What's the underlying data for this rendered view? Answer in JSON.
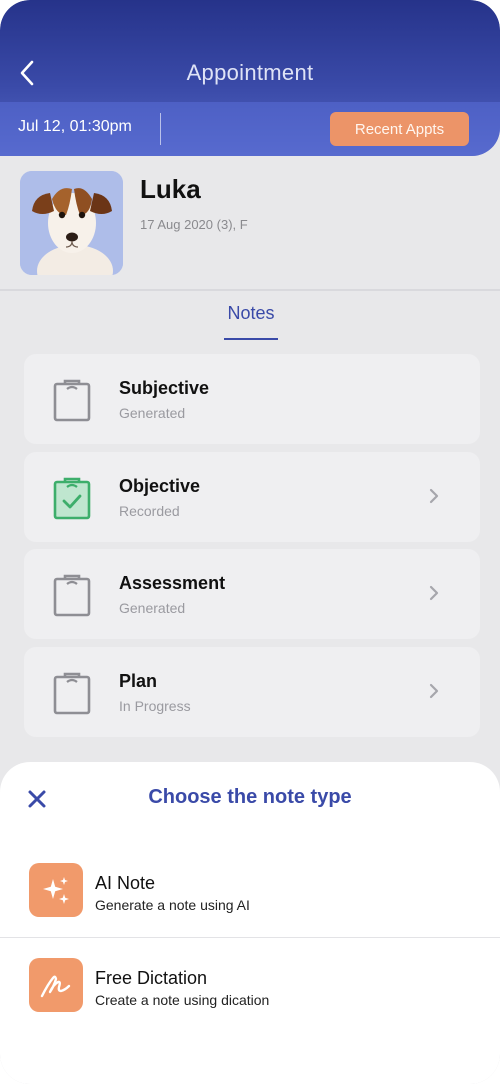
{
  "header": {
    "title": "Appointment",
    "date": "Jul 12, 01:30pm",
    "recent_button": "Recent Appts",
    "colors": {
      "primary": "#3a4aa8",
      "accent": "#ec9468"
    }
  },
  "patient": {
    "name": "Luka",
    "info": "17 Aug 2020 (3), F",
    "photo_icon": "dog-photo"
  },
  "tabs": {
    "notes": "Notes"
  },
  "notes": [
    {
      "title": "Subjective",
      "status": "Generated",
      "icon": "clipboard-icon",
      "chevron": false
    },
    {
      "title": "Objective",
      "status": "Recorded",
      "icon": "clipboard-check-icon",
      "chevron": true
    },
    {
      "title": "Assessment",
      "status": "Generated",
      "icon": "clipboard-icon",
      "chevron": true
    },
    {
      "title": "Plan",
      "status": "In Progress",
      "icon": "clipboard-icon",
      "chevron": true
    }
  ],
  "sheet": {
    "title": "Choose the note type",
    "options": [
      {
        "title": "AI Note",
        "desc": "Generate a note using AI",
        "icon": "sparkle-icon"
      },
      {
        "title": "Free Dictation",
        "desc": "Create a note using dication",
        "icon": "handwriting-icon"
      }
    ]
  }
}
